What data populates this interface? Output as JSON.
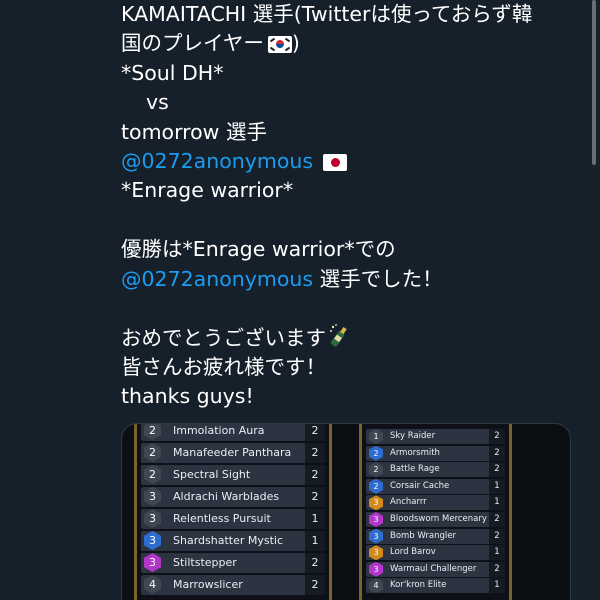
{
  "tweet": {
    "lines": [
      {
        "text": "KAMAITACHI 選手(Twitterは使っておらず韓"
      },
      {
        "text": "国のプレイヤー",
        "suffix": ")"
      },
      {
        "text": "*Soul DH*"
      },
      {
        "text": "vs"
      },
      {
        "text": "tomorrow 選手"
      },
      {
        "mention": "@0272anonymous"
      },
      {
        "text": "*Enrage warrior*"
      },
      {
        "text": "優勝は*Enrage warrior*での"
      },
      {
        "mention": "@0272anonymous",
        "text": " 選手でした！"
      },
      {
        "text": "おめでとうございます"
      },
      {
        "text": "皆さんお疲れ様です！"
      },
      {
        "text": "thanks guys!"
      }
    ]
  },
  "icons": {
    "flag_korea": "flag-south-korea-icon",
    "flag_japan": "flag-japan-icon",
    "celebration": "champagne-bottle-icon"
  },
  "colors": {
    "background": "#15202b",
    "mention": "#1d9bf0",
    "cost_grey": "#3f4752",
    "cost_blue": "#2f6ccf",
    "cost_purple": "#b236c9",
    "cost_orange": "#d28a1c"
  },
  "decks": {
    "left": [
      {
        "cost": "2",
        "name": "Immolation Aura",
        "count": "2",
        "rarity": "grey"
      },
      {
        "cost": "2",
        "name": "Manafeeder Panthara",
        "count": "2",
        "rarity": "grey"
      },
      {
        "cost": "2",
        "name": "Spectral Sight",
        "count": "2",
        "rarity": "grey"
      },
      {
        "cost": "3",
        "name": "Aldrachi Warblades",
        "count": "2",
        "rarity": "grey"
      },
      {
        "cost": "3",
        "name": "Relentless Pursuit",
        "count": "1",
        "rarity": "grey"
      },
      {
        "cost": "3",
        "name": "Shardshatter Mystic",
        "count": "1",
        "rarity": "blue"
      },
      {
        "cost": "3",
        "name": "Stiltstepper",
        "count": "2",
        "rarity": "purple"
      },
      {
        "cost": "4",
        "name": "Marrowslicer",
        "count": "2",
        "rarity": "grey"
      }
    ],
    "right": [
      {
        "cost": "1",
        "name": "Sky Raider",
        "count": "2",
        "rarity": "grey"
      },
      {
        "cost": "2",
        "name": "Armorsmith",
        "count": "2",
        "rarity": "blue"
      },
      {
        "cost": "2",
        "name": "Battle Rage",
        "count": "2",
        "rarity": "grey"
      },
      {
        "cost": "2",
        "name": "Corsair Cache",
        "count": "1",
        "rarity": "blue"
      },
      {
        "cost": "3",
        "name": "Ancharrr",
        "count": "1",
        "rarity": "orange"
      },
      {
        "cost": "3",
        "name": "Bloodsworn Mercenary",
        "count": "2",
        "rarity": "purple"
      },
      {
        "cost": "3",
        "name": "Bomb Wrangler",
        "count": "2",
        "rarity": "blue"
      },
      {
        "cost": "3",
        "name": "Lord Barov",
        "count": "1",
        "rarity": "orange"
      },
      {
        "cost": "3",
        "name": "Warmaul Challenger",
        "count": "2",
        "rarity": "purple"
      },
      {
        "cost": "4",
        "name": "Kor'kron Elite",
        "count": "1",
        "rarity": "grey"
      }
    ]
  }
}
